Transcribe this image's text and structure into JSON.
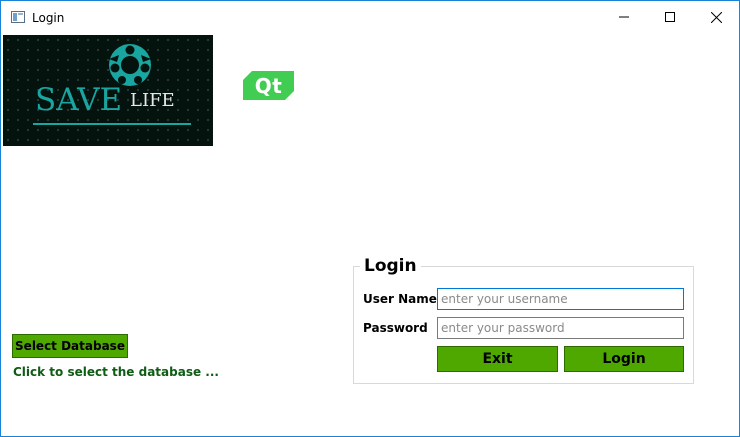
{
  "window": {
    "title": "Login",
    "controls": {
      "minimize": "minimize-icon",
      "maximize": "maximize-icon",
      "close": "close-icon"
    }
  },
  "logo": {
    "word1": "SAVE",
    "word2": "LIFE",
    "accent_color": "#1aa6a0"
  },
  "qt_badge": {
    "text": "Qt",
    "color": "#41cd52"
  },
  "database": {
    "button_label": "Select Database",
    "hint": "Click to select the database ...",
    "hint_color": "#0f5c14"
  },
  "login": {
    "group_title": "Login",
    "username_label": "User Name",
    "username_placeholder": "enter your username",
    "username_value": "",
    "password_label": "Password",
    "password_placeholder": "enter your password",
    "password_value": "",
    "exit_label": "Exit",
    "login_label": "Login"
  },
  "colors": {
    "button_green": "#4fa800",
    "focus_border": "#0078d7",
    "window_border": "#1883d7"
  }
}
